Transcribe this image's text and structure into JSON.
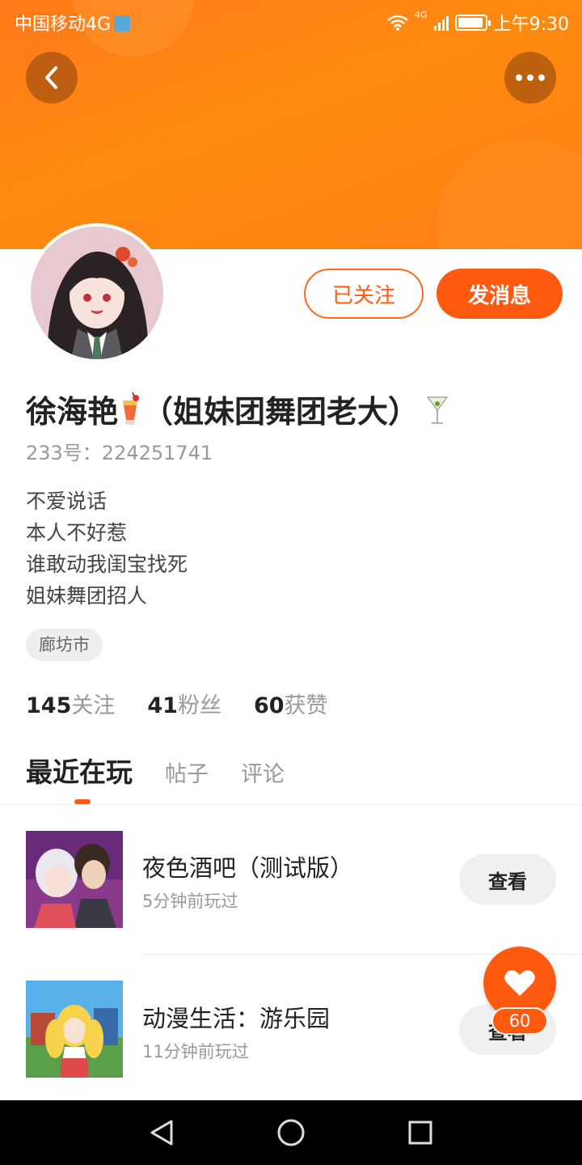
{
  "status_bar": {
    "carrier": "中国移动4G",
    "network": "4G",
    "time": "上午9:30"
  },
  "header": {
    "back_icon": "chevron-left-icon",
    "more_icon": "more-horizontal-icon",
    "accent_color": "#ff7a1a"
  },
  "profile": {
    "name_prefix": "徐海艳",
    "name_suffix": "（姐妹团舞团老大）",
    "user_id": "233号：224251741",
    "bio": [
      "不爱说话",
      "本人不好惹",
      "谁敢动我闺宝找死",
      "姐妹舞团招人"
    ],
    "location": "廊坊市"
  },
  "actions": {
    "follow_label": "已关注",
    "message_label": "发消息"
  },
  "stats": [
    {
      "num": "145",
      "label": "关注"
    },
    {
      "num": "41",
      "label": "粉丝"
    },
    {
      "num": "60",
      "label": "获赞"
    }
  ],
  "tabs": [
    {
      "label": "最近在玩",
      "active": true
    },
    {
      "label": "帖子",
      "active": false
    },
    {
      "label": "评论",
      "active": false
    }
  ],
  "games": [
    {
      "title": "夜色酒吧（测试版）",
      "time": "5分钟前玩过",
      "button": "查看"
    },
    {
      "title": "动漫生活：游乐园",
      "time": "11分钟前玩过",
      "button": "查看"
    }
  ],
  "like_fab": {
    "icon": "heart-icon",
    "count": "60"
  },
  "nav_bar": {
    "back_icon": "triangle-back-icon",
    "home_icon": "circle-home-icon",
    "recents_icon": "square-recents-icon"
  }
}
